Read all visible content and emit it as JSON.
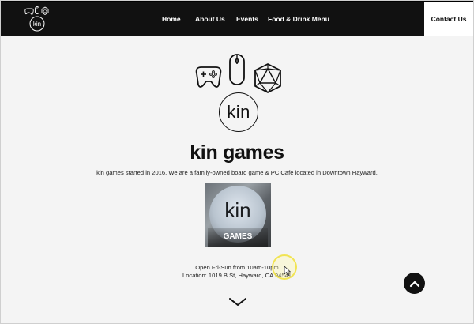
{
  "nav": {
    "items": [
      {
        "label": "Home"
      },
      {
        "label": "About Us"
      },
      {
        "label": "Events"
      },
      {
        "label": "Food & Drink Menu"
      }
    ],
    "contact_label": "Contact Us",
    "logo_text": "kin"
  },
  "hero": {
    "logo_text": "kin",
    "icons": [
      "game-controller-icon",
      "mouse-icon",
      "d20-dice-icon"
    ],
    "title": "kin games",
    "tagline": "kin games started in 2016. We are a family-owned board game & PC Cafe located in Downtown Hayward."
  },
  "photo": {
    "sign_text": "kin",
    "sign_subtext": "GAMES"
  },
  "info": {
    "hours": "Open Fri-Sun from 10am-10pm",
    "location": "Location: 1019 B St, Hayward, CA 94541"
  },
  "controls": {
    "scroll_top_icon": "chevron-up-icon",
    "scroll_down_icon": "chevron-down-icon"
  },
  "colors": {
    "header_bg": "#111111",
    "page_bg": "#f4f4f4",
    "accent_cursor": "#f0e13c"
  }
}
